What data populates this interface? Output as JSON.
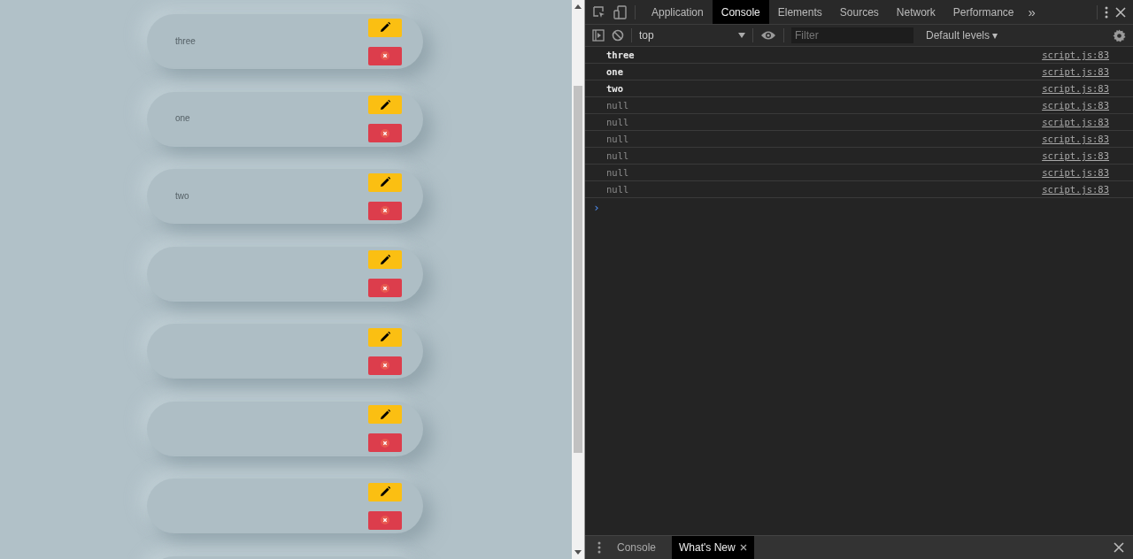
{
  "todo_items": [
    {
      "kind": "labeled",
      "text": "three"
    },
    {
      "kind": "labeled",
      "text": "one"
    },
    {
      "kind": "labeled",
      "text": "two"
    },
    {
      "kind": "blank"
    },
    {
      "kind": "blank"
    },
    {
      "kind": "blank"
    },
    {
      "kind": "blank"
    },
    {
      "kind": "edge"
    }
  ],
  "devtools": {
    "tabs": [
      {
        "label": "Application",
        "selected": false
      },
      {
        "label": "Console",
        "selected": true
      },
      {
        "label": "Elements",
        "selected": false
      },
      {
        "label": "Sources",
        "selected": false
      },
      {
        "label": "Network",
        "selected": false
      },
      {
        "label": "Performance",
        "selected": false
      }
    ],
    "more_tabs": "»",
    "context": "top",
    "filter": {
      "placeholder": "Filter"
    },
    "levels": "Default levels ▾",
    "messages": [
      {
        "kind": "string",
        "text": "three",
        "source": "script.js:83"
      },
      {
        "kind": "string",
        "text": "one",
        "source": "script.js:83"
      },
      {
        "kind": "string",
        "text": "two",
        "source": "script.js:83"
      },
      {
        "kind": "null",
        "text": "null",
        "source": "script.js:83"
      },
      {
        "kind": "null",
        "text": "null",
        "source": "script.js:83"
      },
      {
        "kind": "null",
        "text": "null",
        "source": "script.js:83"
      },
      {
        "kind": "null",
        "text": "null",
        "source": "script.js:83"
      },
      {
        "kind": "null",
        "text": "null",
        "source": "script.js:83"
      },
      {
        "kind": "null",
        "text": "null",
        "source": "script.js:83"
      }
    ],
    "prompt": "›",
    "drawer_tabs": [
      {
        "label": "Console",
        "selected": false,
        "closable": false
      },
      {
        "label": "What's New",
        "selected": true,
        "closable": true
      }
    ]
  }
}
